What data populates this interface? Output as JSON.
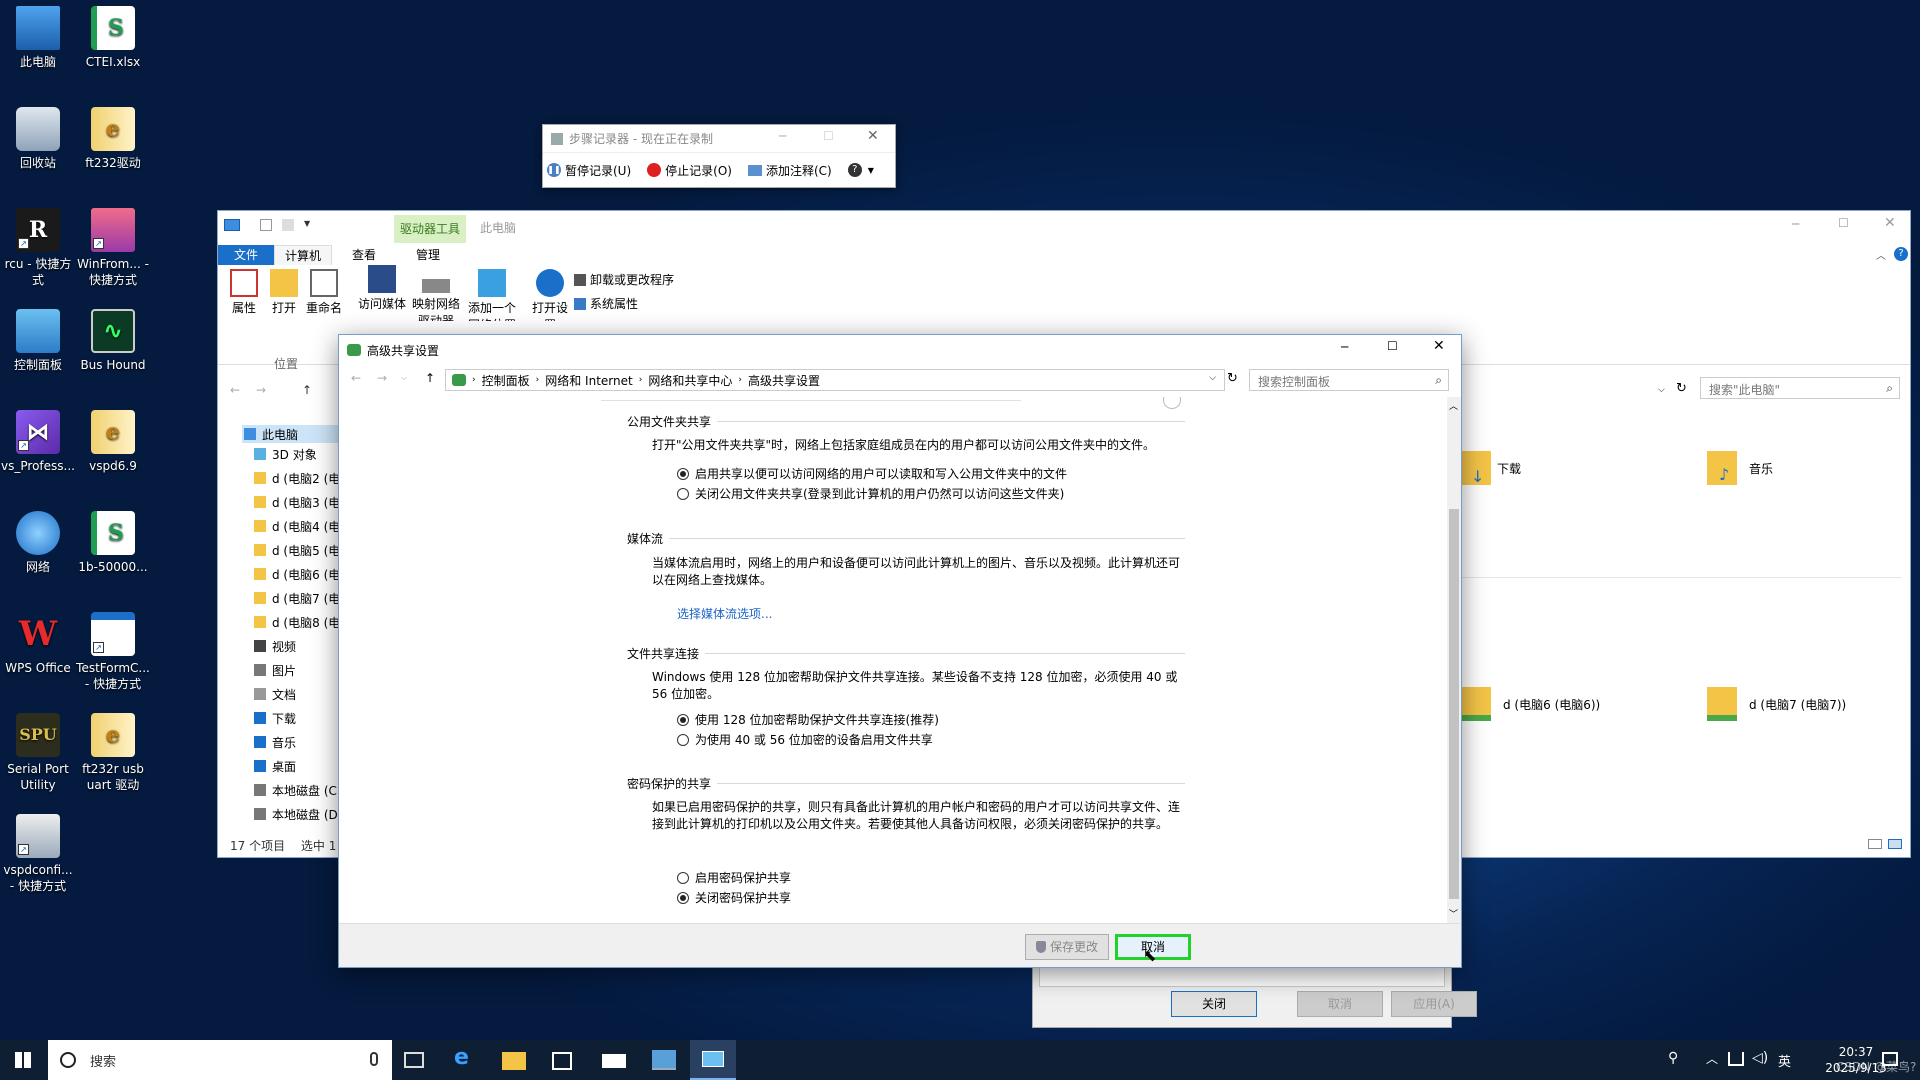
{
  "desktop": {
    "icons": [
      {
        "label": "此电脑",
        "icon": "computer-icon"
      },
      {
        "label": "CTEI.xlsx",
        "icon": "spreadsheet-icon"
      },
      {
        "label": "回收站",
        "icon": "recycle-bin-icon"
      },
      {
        "label": "ft232驱动",
        "icon": "folder-zip-icon"
      },
      {
        "label": "rcu - 快捷方式",
        "icon": "r-app-icon"
      },
      {
        "label": "WinFrom... - 快捷方式",
        "icon": "winrar-icon"
      },
      {
        "label": "控制面板",
        "icon": "control-panel-icon"
      },
      {
        "label": "Bus Hound",
        "icon": "bus-hound-icon"
      },
      {
        "label": "vs_Profess...",
        "icon": "visual-studio-icon"
      },
      {
        "label": "vspd6.9",
        "icon": "folder-zip-icon"
      },
      {
        "label": "网络",
        "icon": "network-icon"
      },
      {
        "label": "1b-50000...",
        "icon": "spreadsheet-icon"
      },
      {
        "label": "WPS Office",
        "icon": "wps-icon"
      },
      {
        "label": "TestFormC... - 快捷方式",
        "icon": "app-window-icon"
      },
      {
        "label": "Serial Port Utility",
        "icon": "serial-port-icon"
      },
      {
        "label": "ft232r usb uart 驱动",
        "icon": "folder-zip-icon"
      },
      {
        "label": "vspdconfi... - 快捷方式",
        "icon": "vspd-config-icon"
      }
    ]
  },
  "steps_recorder": {
    "title": "步骤记录器 - 现在正在录制",
    "pause": "暂停记录(U)",
    "stop": "停止记录(O)",
    "comment": "添加注释(C)"
  },
  "explorer": {
    "title": "此电脑",
    "context_tab": "驱动器工具",
    "tabs": [
      "文件",
      "计算机",
      "查看",
      "管理"
    ],
    "ribbon": {
      "properties": "属性",
      "open": "打开",
      "rename": "重命名",
      "access_media": "访问媒体",
      "map_drive": "映射网络驱动器",
      "add_location": "添加一个网络位置",
      "open_settings": "打开设置",
      "uninstall": "卸载或更改程序",
      "system_props": "系统属性",
      "manage": "管理",
      "group_location": "位置"
    },
    "search_placeholder": "搜索\"此电脑\"",
    "nav": [
      "此电脑",
      "3D 对象",
      "d (电脑2 (电",
      "d (电脑3 (电",
      "d (电脑4 (电",
      "d (电脑5 (电",
      "d (电脑6 (电",
      "d (电脑7 (电",
      "d (电脑8 (电",
      "视频",
      "图片",
      "文档",
      "下载",
      "音乐",
      "桌面",
      "本地磁盘 (C:",
      "本地磁盘 (D:"
    ],
    "content": {
      "downloads": "下载",
      "music": "音乐",
      "drive6": "d (电脑6 (电脑6))",
      "drive7": "d (电脑7 (电脑7))"
    },
    "status_count": "17 个项目",
    "status_selected": "选中 1"
  },
  "background_dialog": {
    "close": "关闭",
    "cancel": "取消",
    "apply": "应用(A)"
  },
  "dialog": {
    "title": "高级共享设置",
    "breadcrumb": [
      "控制面板",
      "网络和 Internet",
      "网络和共享中心",
      "高级共享设置"
    ],
    "search_placeholder": "搜索控制面板",
    "sections": {
      "public": {
        "title": "公用文件夹共享",
        "desc": "打开\"公用文件夹共享\"时，网络上包括家庭组成员在内的用户都可以访问公用文件夹中的文件。",
        "opt1": "启用共享以便可以访问网络的用户可以读取和写入公用文件夹中的文件",
        "opt2": "关闭公用文件夹共享(登录到此计算机的用户仍然可以访问这些文件夹)"
      },
      "media": {
        "title": "媒体流",
        "desc": "当媒体流启用时，网络上的用户和设备便可以访问此计算机上的图片、音乐以及视频。此计算机还可以在网络上查找媒体。",
        "link": "选择媒体流选项..."
      },
      "fileconn": {
        "title": "文件共享连接",
        "desc": "Windows 使用 128 位加密帮助保护文件共享连接。某些设备不支持 128 位加密，必须使用 40 或 56 位加密。",
        "opt1": "使用 128 位加密帮助保护文件共享连接(推荐)",
        "opt2": "为使用 40 或 56 位加密的设备启用文件共享"
      },
      "password": {
        "title": "密码保护的共享",
        "desc": "如果已启用密码保护的共享，则只有具备此计算机的用户帐户和密码的用户才可以访问共享文件、连接到此计算机的打印机以及公用文件夹。若要使其他人具备访问权限，必须关闭密码保护的共享。",
        "opt1": "启用密码保护共享",
        "opt2": "关闭密码保护共享"
      }
    },
    "save_button": "保存更改",
    "cancel_button": "取消"
  },
  "taskbar": {
    "search_placeholder": "搜索",
    "time": "20:37",
    "date": "2025/9/13",
    "ime": "英",
    "watermark": "CSDN @菜鸟?"
  }
}
